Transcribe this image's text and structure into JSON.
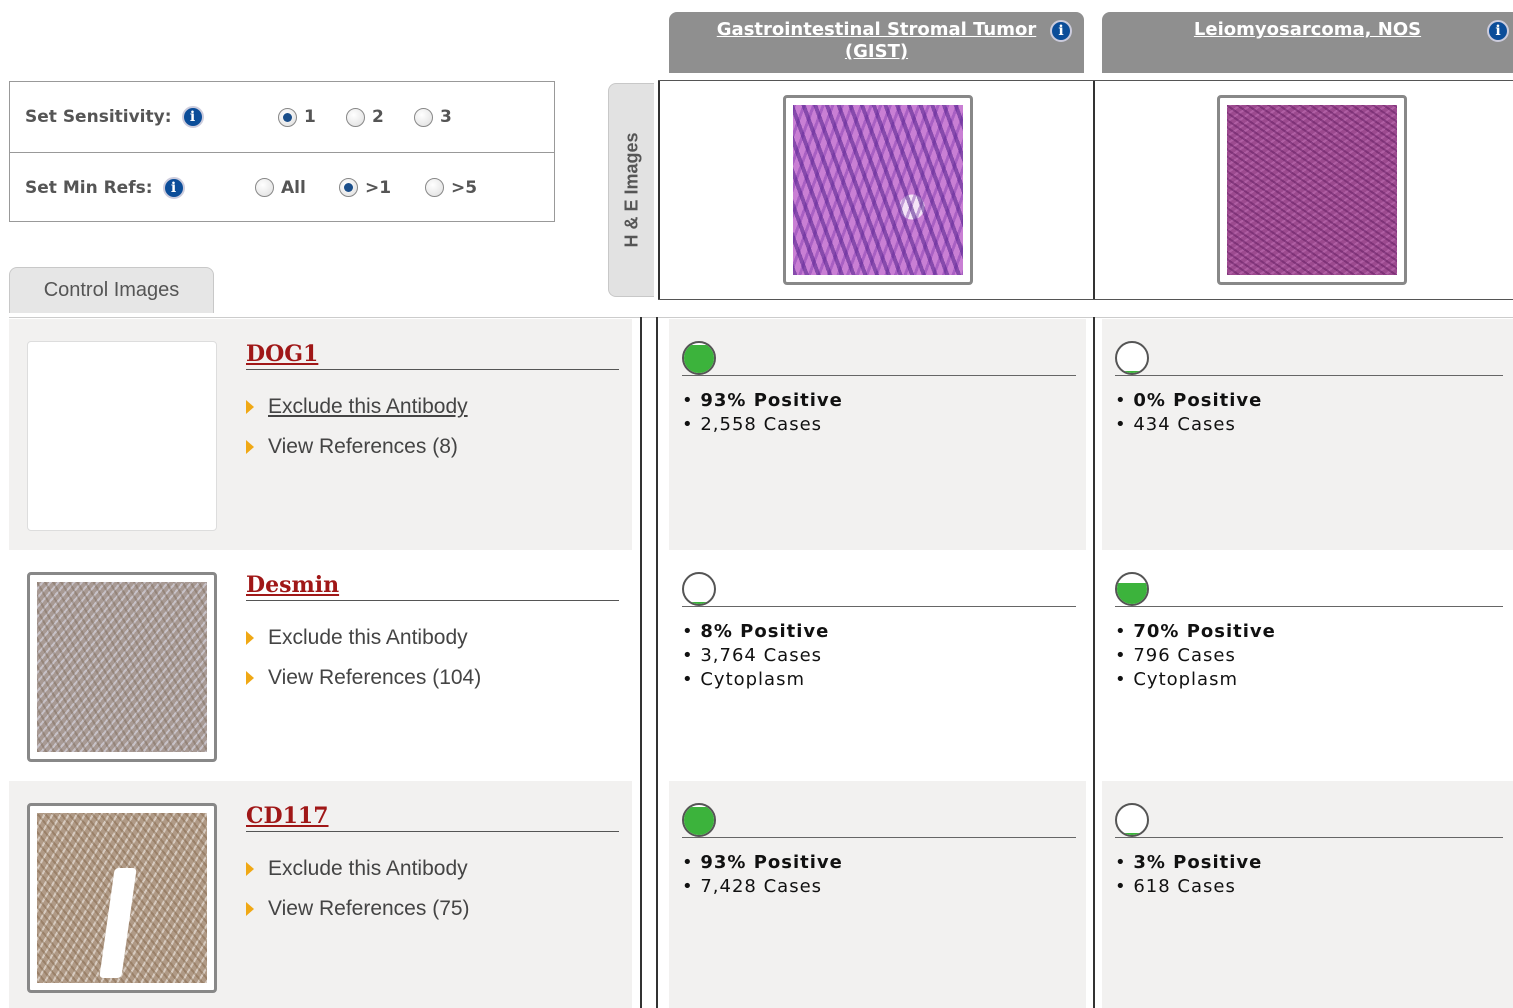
{
  "settings": {
    "sensitivity_label": "Set Sensitivity:",
    "sensitivity_options": [
      "1",
      "2",
      "3"
    ],
    "sensitivity_selected": "1",
    "minrefs_label": "Set Min Refs:",
    "minrefs_options": [
      "All",
      ">1",
      ">5"
    ],
    "minrefs_selected": ">1"
  },
  "tabs": {
    "control_images": "Control Images",
    "he_images": "H & E Images"
  },
  "columns": [
    {
      "title": "Gastrointestinal Stromal Tumor (GIST)"
    },
    {
      "title": "Leiomyosarcoma, NOS"
    }
  ],
  "antibodies": [
    {
      "name": "DOG1",
      "exclude_label": "Exclude this Antibody",
      "references_label": "View References (8)",
      "results": [
        {
          "positive": "93% Positive",
          "cases": "2,558 Cases",
          "location": "",
          "level": 0.93
        },
        {
          "positive": "0% Positive",
          "cases": "434 Cases",
          "location": "",
          "level": 0.0
        }
      ]
    },
    {
      "name": "Desmin",
      "exclude_label": "Exclude this Antibody",
      "references_label": "View References (104)",
      "results": [
        {
          "positive": "8% Positive",
          "cases": "3,764 Cases",
          "location": "Cytoplasm",
          "level": 0.08
        },
        {
          "positive": "70% Positive",
          "cases": "796 Cases",
          "location": "Cytoplasm",
          "level": 0.7
        }
      ]
    },
    {
      "name": "CD117",
      "exclude_label": "Exclude this Antibody",
      "references_label": "View References (75)",
      "results": [
        {
          "positive": "93% Positive",
          "cases": "7,428 Cases",
          "location": "",
          "level": 0.93
        },
        {
          "positive": "3% Positive",
          "cases": "618 Cases",
          "location": "",
          "level": 0.03
        }
      ]
    }
  ],
  "colors": {
    "positive_fill": "#3cb33c",
    "antibody_name": "#a01717",
    "header_bg": "#8f8f8f",
    "info_icon": "#0b4d99"
  }
}
